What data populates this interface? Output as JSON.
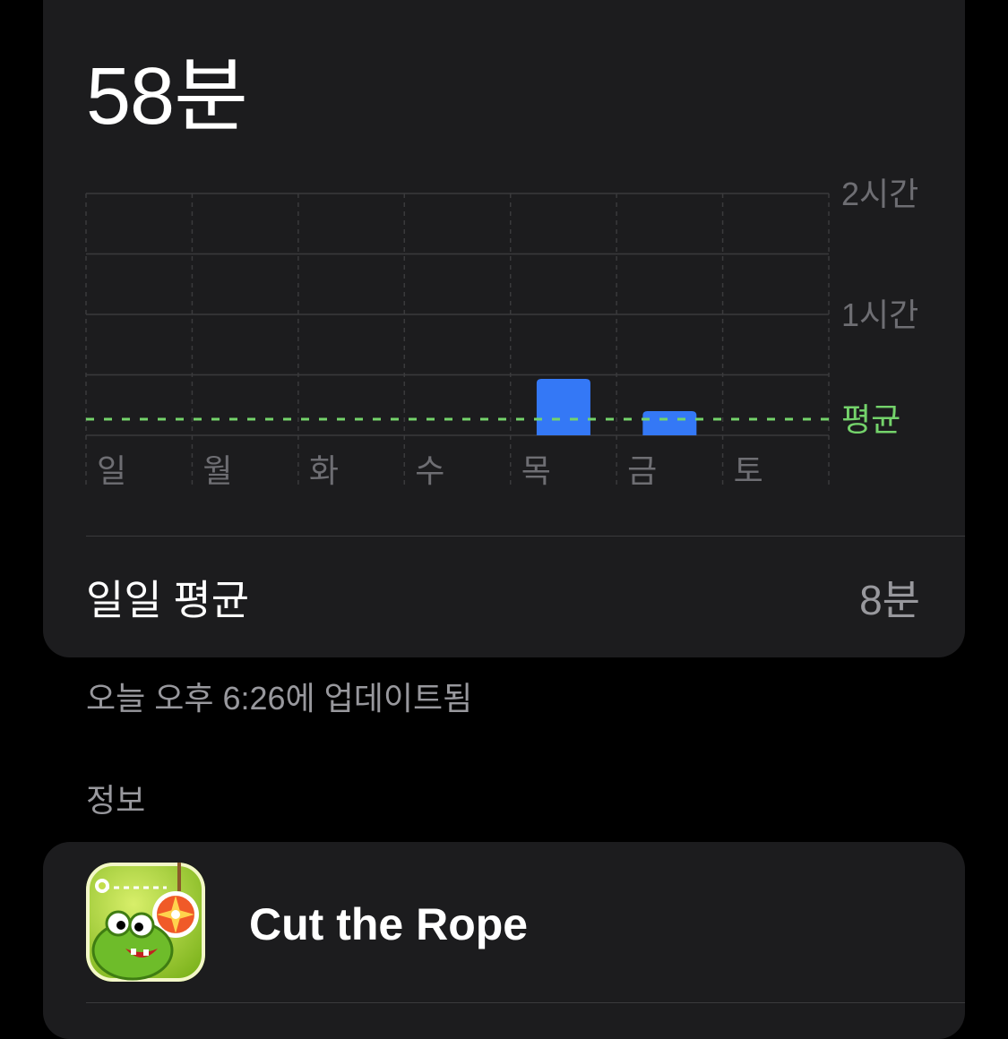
{
  "summary": {
    "total": "58분"
  },
  "chart_data": {
    "type": "bar",
    "categories": [
      "일",
      "월",
      "화",
      "수",
      "목",
      "금",
      "토"
    ],
    "values": [
      0,
      0,
      0,
      0,
      28,
      12,
      0
    ],
    "unit": "minutes",
    "y_ticks": [
      {
        "value": 120,
        "label": "2시간"
      },
      {
        "value": 60,
        "label": "1시간"
      }
    ],
    "ylim": [
      0,
      120
    ],
    "average": {
      "value": 8,
      "label": "평균"
    },
    "colors": {
      "bar": "#3478f6",
      "average": "#74d36b",
      "grid": "#3a3a3c",
      "label": "#6e6e73"
    }
  },
  "daily_average": {
    "label": "일일 평균",
    "value": "8분"
  },
  "updated_text": "오늘 오후 6:26에 업데이트됨",
  "section": {
    "title": "정보"
  },
  "app": {
    "name": "Cut the Rope",
    "icon": "cut-the-rope-app-icon"
  }
}
